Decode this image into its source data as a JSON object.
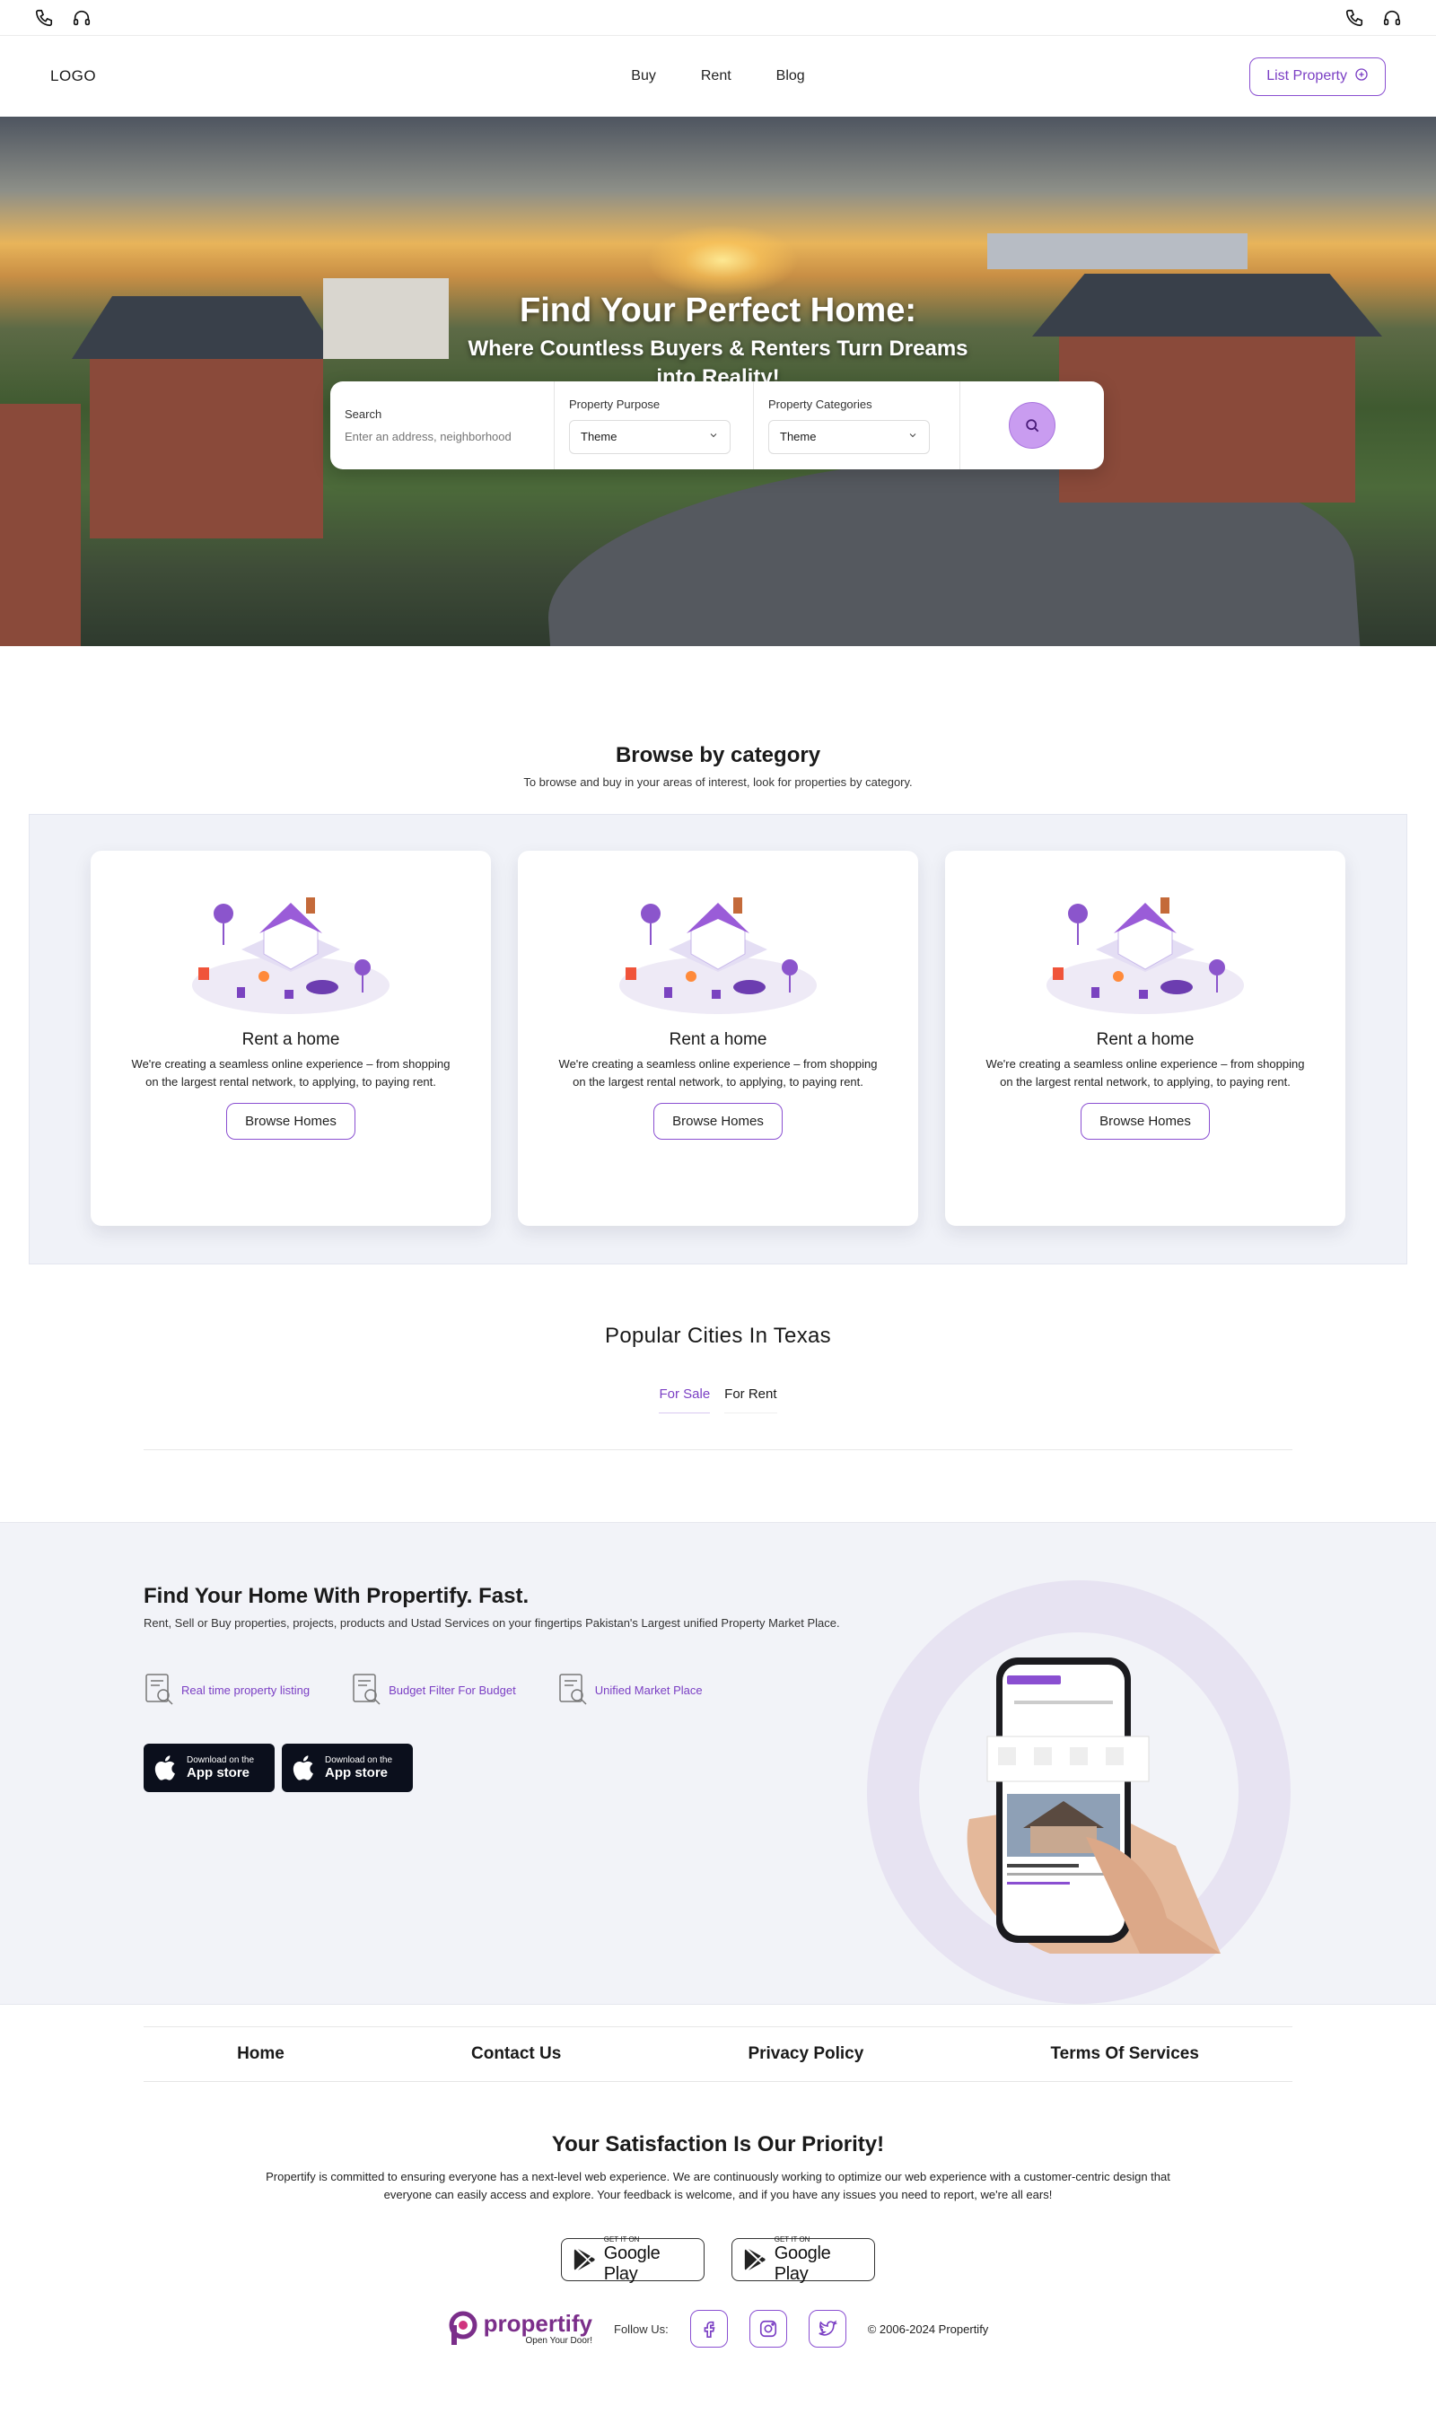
{
  "topbar": {
    "left_icons": [
      "phone-icon",
      "headset-icon"
    ],
    "right_icons": [
      "phone-icon",
      "headset-icon"
    ]
  },
  "nav": {
    "logo": "LOGO",
    "links": [
      "Buy",
      "Rent",
      "Blog"
    ],
    "list_property": "List Property"
  },
  "hero": {
    "title": "Find Your Perfect Home:",
    "subtitle_line1": "Where Countless Buyers & Renters Turn Dreams",
    "subtitle_line2": "into Reality!",
    "search": {
      "label": "Search",
      "placeholder": "Enter an address, neighborhood"
    },
    "purpose": {
      "label": "Property Purpose",
      "value": "Theme"
    },
    "categories": {
      "label": "Property Categories",
      "value": "Theme"
    }
  },
  "browse": {
    "title": "Browse by category",
    "subtitle": "To browse and buy in your areas of interest, look for properties by category.",
    "cards": [
      {
        "title": "Rent a home",
        "text": "We're creating a seamless online experience – from shopping on the largest rental network, to applying, to paying rent.",
        "button": "Browse Homes"
      },
      {
        "title": "Rent a home",
        "text": "We're creating a seamless online experience – from shopping on the largest rental network, to applying, to paying rent.",
        "button": "Browse Homes"
      },
      {
        "title": "Rent a home",
        "text": "We're creating a seamless online experience – from shopping on the largest rental network, to applying, to paying rent.",
        "button": "Browse Homes"
      }
    ]
  },
  "cities": {
    "title": "Popular Cities In Texas",
    "tabs": [
      "For Sale",
      "For Rent"
    ],
    "active_tab": "For Sale"
  },
  "promo": {
    "title": "Find Your Home With Propertify. Fast.",
    "text": "Rent, Sell or Buy properties, projects, products and Ustad Services on your fingertips Pakistan's Largest unified Property Market Place.",
    "features": [
      "Real time property listing",
      "Budget Filter For Budget",
      "Unified Market Place"
    ],
    "stores": [
      {
        "small": "Download on the",
        "big": "App store"
      },
      {
        "small": "Download on the",
        "big": "App store"
      }
    ]
  },
  "footer": {
    "links": [
      "Home",
      "Contact Us",
      "Privacy Policy",
      "Terms Of Services"
    ],
    "satisfaction_title": "Your Satisfaction Is Our Priority!",
    "satisfaction_text": "Propertify is committed to ensuring everyone has a next-level web experience. We are continuously working to optimize our web experience with a customer-centric design that everyone can easily access and explore. Your feedback is welcome, and if you have any issues you need to report, we're all ears!",
    "gplay": [
      {
        "small": "GET IT ON",
        "big": "Google Play"
      },
      {
        "small": "GET IT ON",
        "big": "Google Play"
      }
    ],
    "brand_name": "propertify",
    "brand_tag": "Open Your Door!",
    "follow": "Follow Us:",
    "social": [
      "facebook-icon",
      "instagram-icon",
      "twitter-icon"
    ],
    "copyright": "© 2006-2024 Propertify"
  },
  "colors": {
    "accent": "#8a4fd1",
    "accent_text": "#7b3fc4",
    "band": "#f0f2f8",
    "store_dark": "#0b0f1c"
  }
}
